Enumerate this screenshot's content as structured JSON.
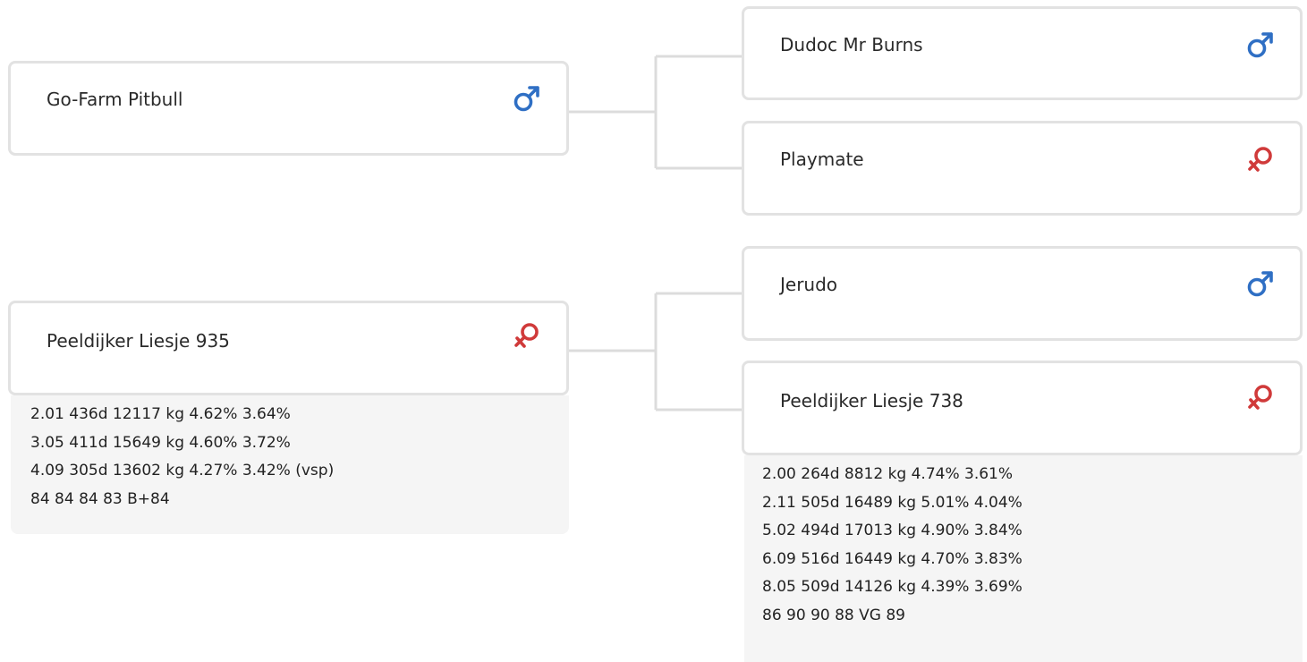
{
  "colors": {
    "male": "#2f6fc4",
    "female": "#d03a3a",
    "connector": "#dcdcdc"
  },
  "subject": {
    "sire": {
      "name": "Go-Farm Pitbull",
      "sex_icon": "male-icon",
      "sire": {
        "name": "Dudoc Mr Burns",
        "sex_icon": "male-icon"
      },
      "dam": {
        "name": "Playmate",
        "sex_icon": "female-icon"
      }
    },
    "dam": {
      "name": "Peeldijker Liesje 935",
      "sex_icon": "female-icon",
      "stats": [
        "2.01 436d 12117 kg 4.62% 3.64%",
        "3.05 411d 15649 kg 4.60% 3.72%",
        "4.09 305d 13602 kg 4.27% 3.42% (vsp)",
        "84 84 84 83 B+84"
      ],
      "sire": {
        "name": "Jerudo",
        "sex_icon": "male-icon"
      },
      "dam": {
        "name": "Peeldijker Liesje 738",
        "sex_icon": "female-icon",
        "stats": [
          "2.00 264d 8812 kg 4.74% 3.61%",
          "2.11 505d 16489 kg 5.01% 4.04%",
          "5.02 494d 17013 kg 4.90% 3.84%",
          "6.09 516d 16449 kg 4.70% 3.83%",
          "8.05 509d 14126 kg 4.39% 3.69%",
          "86 90 90 88 VG 89"
        ]
      }
    }
  }
}
